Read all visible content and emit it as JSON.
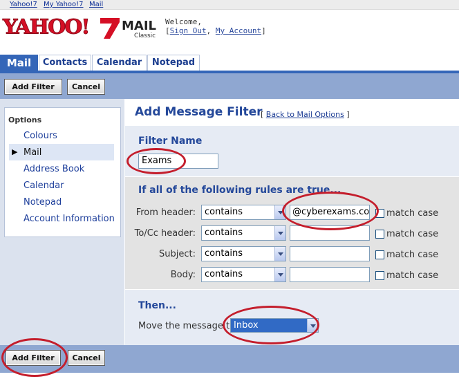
{
  "top_links": [
    "Yahoo!7",
    "My Yahoo!7",
    "Mail"
  ],
  "logo": {
    "brand": "YAHOO!",
    "product": "MAIL",
    "edition": "Classic"
  },
  "welcome": {
    "greeting": "Welcome,",
    "bracket_open": "[",
    "sign_out": "Sign Out",
    "comma": ",",
    "my_account": "My Account",
    "bracket_close": "]"
  },
  "tabs": [
    {
      "label": "Mail",
      "active": true
    },
    {
      "label": "Contacts",
      "active": false
    },
    {
      "label": "Calendar",
      "active": false
    },
    {
      "label": "Notepad",
      "active": false
    }
  ],
  "toolbar": {
    "add_filter": "Add Filter",
    "cancel": "Cancel"
  },
  "options": {
    "heading": "Options",
    "items": [
      "Colours",
      "Mail",
      "Address Book",
      "Calendar",
      "Notepad",
      "Account Information"
    ],
    "selected": "Mail"
  },
  "page": {
    "title": "Add Message Filter",
    "back_open": "[",
    "back_link": "Back to Mail Options",
    "back_close": "]"
  },
  "filter_name": {
    "label": "Filter Name",
    "value": "Exams"
  },
  "rules": {
    "heading": "If all of the following rules are true...",
    "match_case_label": "match case",
    "rows": [
      {
        "label": "From header:",
        "operator": "contains",
        "value": "@cyberexams.cor"
      },
      {
        "label": "To/Cc header:",
        "operator": "contains",
        "value": ""
      },
      {
        "label": "Subject:",
        "operator": "contains",
        "value": ""
      },
      {
        "label": "Body:",
        "operator": "contains",
        "value": ""
      }
    ]
  },
  "then": {
    "heading": "Then...",
    "move_label": "Move the message to:",
    "folder": "Inbox"
  },
  "colors": {
    "tab_blue": "#3466b8",
    "toolbar": "#8fa7d1",
    "title_blue": "#24489a",
    "annotation_red": "#c41e2c",
    "yahoo_red": "#d50f25"
  }
}
